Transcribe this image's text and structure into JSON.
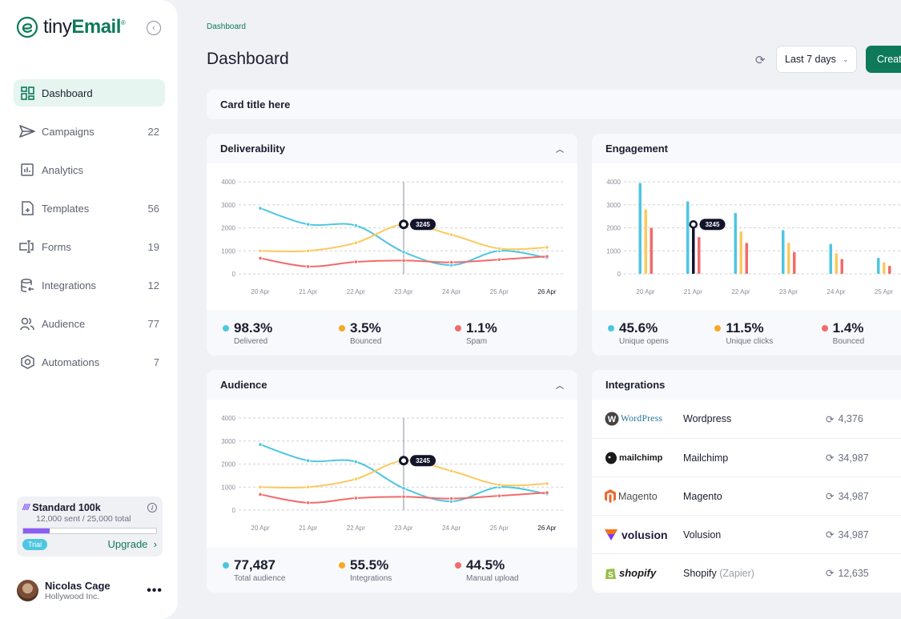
{
  "brand": {
    "name_light": "tiny",
    "name_bold": "Email",
    "reg": "®"
  },
  "sidebar": {
    "items": [
      {
        "label": "Dashboard",
        "count": "",
        "icon": "dashboard-icon",
        "active": true
      },
      {
        "label": "Campaigns",
        "count": "22",
        "icon": "send-icon"
      },
      {
        "label": "Analytics",
        "count": "",
        "icon": "analytics-icon"
      },
      {
        "label": "Templates",
        "count": "56",
        "icon": "template-icon"
      },
      {
        "label": "Forms",
        "count": "19",
        "icon": "form-icon"
      },
      {
        "label": "Integrations",
        "count": "12",
        "icon": "database-icon"
      },
      {
        "label": "Audience",
        "count": "77",
        "icon": "users-icon"
      },
      {
        "label": "Automations",
        "count": "7",
        "icon": "automation-icon"
      }
    ],
    "plan": {
      "name": "Standard 100k",
      "usage": "12,000 sent / 25,000 total",
      "progress": 0.2,
      "badge": "Trial",
      "upgrade": "Upgrade",
      "accent": "#8b5cf6"
    },
    "user": {
      "name": "Nicolas Cage",
      "org": "Hollywood Inc."
    }
  },
  "header": {
    "breadcrumb": "Dashboard",
    "title": "Dashboard",
    "range": "Last 7 days",
    "create": "Create"
  },
  "card_title": "Card title here",
  "colors": {
    "blue": "#4ec6e0",
    "yellow": "#fbc95e",
    "red": "#f26b6b",
    "green": "#0e7a5a",
    "dark": "#12152a"
  },
  "deliverability": {
    "title": "Deliverability",
    "stats": [
      {
        "value": "98.3%",
        "label": "Delivered",
        "color": "#4ec6e0"
      },
      {
        "value": "3.5%",
        "label": "Bounced",
        "color": "#f9a825"
      },
      {
        "value": "1.1%",
        "label": "Spam",
        "color": "#f26b6b"
      }
    ]
  },
  "engagement": {
    "title": "Engagement",
    "stats": [
      {
        "value": "45.6%",
        "label": "Unique opens",
        "color": "#4ec6e0"
      },
      {
        "value": "11.5%",
        "label": "Unique clicks",
        "color": "#f9a825"
      },
      {
        "value": "1.4%",
        "label": "Bounced",
        "color": "#f26b6b"
      }
    ]
  },
  "audience": {
    "title": "Audience",
    "stats": [
      {
        "value": "77,487",
        "label": "Total audience",
        "color": "#4ec6e0"
      },
      {
        "value": "55.5%",
        "label": "Integrations",
        "color": "#f9a825"
      },
      {
        "value": "44.5%",
        "label": "Manual upload",
        "color": "#f26b6b"
      }
    ]
  },
  "integrations": {
    "title": "Integrations",
    "rows": [
      {
        "logo": "WordPress",
        "name": "Wordpress",
        "suffix": "",
        "count": "4,376"
      },
      {
        "logo": "mailchimp",
        "name": "Mailchimp",
        "suffix": "",
        "count": "34,987"
      },
      {
        "logo": "Magento",
        "name": "Magento",
        "suffix": "",
        "count": "34,987"
      },
      {
        "logo": "volusion",
        "name": "Volusion",
        "suffix": "",
        "count": "34,987"
      },
      {
        "logo": "shopify",
        "name": "Shopify",
        "suffix": "(Zapier)",
        "count": "12,635"
      }
    ]
  },
  "chart_data": [
    {
      "id": "deliverability",
      "type": "line",
      "categories": [
        "20 Apr",
        "21 Apr",
        "22 Apr",
        "23 Apr",
        "24 Apr",
        "25 Apr",
        "26 Apr"
      ],
      "yticks": [
        0,
        1000,
        2000,
        3000,
        4000
      ],
      "ylim": [
        0,
        4000
      ],
      "grid": true,
      "highlight": {
        "index": 3,
        "label": "3245",
        "bold_category": 6
      },
      "series": [
        {
          "name": "Delivered",
          "color": "#4ec6e0",
          "values": [
            2850,
            2150,
            2100,
            950,
            380,
            1000,
            700
          ]
        },
        {
          "name": "Bounced",
          "color": "#fbc95e",
          "values": [
            1000,
            1000,
            1350,
            2150,
            1700,
            1100,
            1150
          ]
        },
        {
          "name": "Spam",
          "color": "#f26b6b",
          "values": [
            680,
            320,
            520,
            580,
            500,
            620,
            760
          ]
        }
      ]
    },
    {
      "id": "engagement",
      "type": "bar",
      "categories": [
        "20 Apr",
        "21 Apr",
        "22 Apr",
        "23 Apr",
        "24 Apr",
        "25 Apr"
      ],
      "yticks": [
        0,
        1000,
        2000,
        3000,
        4000
      ],
      "ylim": [
        0,
        4000
      ],
      "grid": true,
      "highlight": {
        "index": 1,
        "series": 1,
        "label": "3245"
      },
      "series": [
        {
          "name": "Unique opens",
          "color": "#4ec6e0",
          "values": [
            3950,
            3150,
            2650,
            1900,
            1300,
            700
          ]
        },
        {
          "name": "Unique clicks",
          "color": "#fbc95e",
          "values": [
            2800,
            2150,
            1850,
            1350,
            900,
            500
          ]
        },
        {
          "name": "Bounced",
          "color": "#f26b6b",
          "values": [
            2000,
            1600,
            1350,
            950,
            650,
            350
          ]
        }
      ]
    },
    {
      "id": "audience",
      "type": "line",
      "categories": [
        "20 Apr",
        "21 Apr",
        "22 Apr",
        "23 Apr",
        "24 Apr",
        "25 Apr",
        "26 Apr"
      ],
      "yticks": [
        0,
        1000,
        2000,
        3000,
        4000
      ],
      "ylim": [
        0,
        4000
      ],
      "grid": true,
      "highlight": {
        "index": 3,
        "label": "3245",
        "bold_category": 6
      },
      "series": [
        {
          "name": "Total audience",
          "color": "#4ec6e0",
          "values": [
            2850,
            2150,
            2100,
            950,
            380,
            1000,
            700
          ]
        },
        {
          "name": "Integrations",
          "color": "#fbc95e",
          "values": [
            1000,
            1000,
            1350,
            2150,
            1700,
            1100,
            1150
          ]
        },
        {
          "name": "Manual upload",
          "color": "#f26b6b",
          "values": [
            680,
            320,
            520,
            580,
            500,
            620,
            760
          ]
        }
      ]
    }
  ]
}
